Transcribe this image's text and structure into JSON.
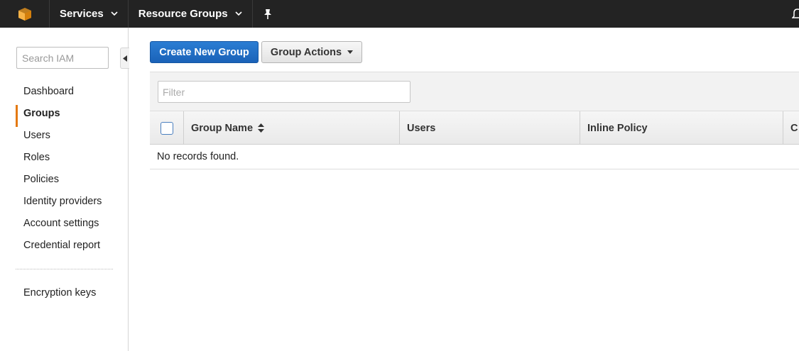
{
  "topnav": {
    "services_label": "Services",
    "resource_groups_label": "Resource Groups"
  },
  "sidebar": {
    "search_placeholder": "Search IAM",
    "items": [
      {
        "label": "Dashboard",
        "active": false
      },
      {
        "label": "Groups",
        "active": true
      },
      {
        "label": "Users",
        "active": false
      },
      {
        "label": "Roles",
        "active": false
      },
      {
        "label": "Policies",
        "active": false
      },
      {
        "label": "Identity providers",
        "active": false
      },
      {
        "label": "Account settings",
        "active": false
      },
      {
        "label": "Credential report",
        "active": false
      }
    ],
    "encryption_label": "Encryption keys"
  },
  "toolbar": {
    "create_label": "Create New Group",
    "actions_label": "Group Actions"
  },
  "table": {
    "filter_placeholder": "Filter",
    "columns": [
      "Group Name",
      "Users",
      "Inline Policy",
      "C"
    ],
    "empty_message": "No records found."
  },
  "colors": {
    "topbar": "#232323",
    "primary_button": "#1a62b8",
    "active_indicator": "#e47911"
  }
}
